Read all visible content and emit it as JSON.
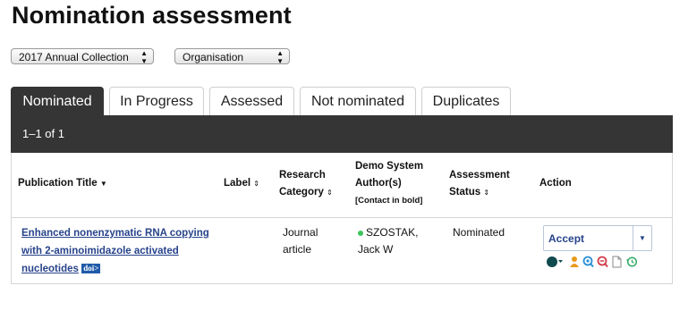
{
  "page": {
    "title": "Nomination assessment"
  },
  "filters": {
    "collection": "2017 Annual Collection",
    "group": "Organisation"
  },
  "tabs": [
    {
      "label": "Nominated",
      "active": true
    },
    {
      "label": "In Progress",
      "active": false
    },
    {
      "label": "Assessed",
      "active": false
    },
    {
      "label": "Not nominated",
      "active": false
    },
    {
      "label": "Duplicates",
      "active": false
    }
  ],
  "results": {
    "range": "1–1 of 1"
  },
  "columns": {
    "title": "Publication Title",
    "label": "Label",
    "category_1": "Research",
    "category_2": "Category",
    "authors_1": "Demo System",
    "authors_2": "Author(s)",
    "authors_note": "[Contact in bold]",
    "status_1": "Assessment",
    "status_2": "Status",
    "action": "Action"
  },
  "rows": [
    {
      "title_1": "Enhanced nonenzymatic RNA copying",
      "title_2": "with 2-aminoimidazole activated",
      "title_3": "nucleotides",
      "doi": "doi>",
      "label": "",
      "category_1": "Journal",
      "category_2": "article",
      "author_1": "SZOSTAK,",
      "author_2": "Jack W",
      "status": "Nominated",
      "action": "Accept"
    }
  ],
  "colors": {
    "tab_active": "#353535",
    "link": "#27438a",
    "doi_badge": "#1f5aa8",
    "author_status_dot": "#3cc45b"
  },
  "action_icons": [
    "color-picker-icon",
    "person-icon",
    "search-refresh-icon",
    "search-remove-icon",
    "document-icon",
    "history-icon"
  ]
}
